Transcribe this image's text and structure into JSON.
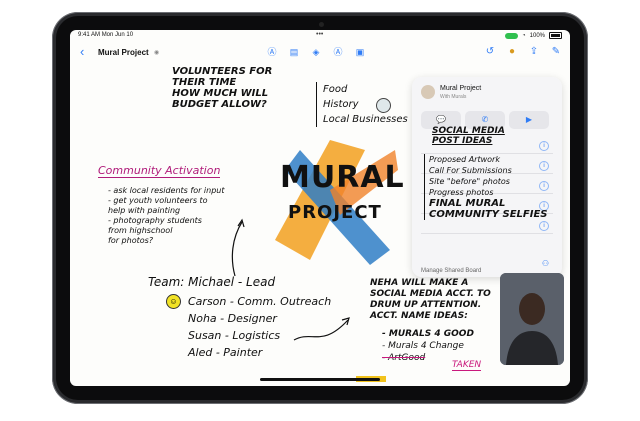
{
  "status_bar": {
    "time": "9:41 AM",
    "date": "Mon Jun 10",
    "battery": "100%"
  },
  "toolbar": {
    "title": "Mural Project"
  },
  "board": {
    "volunteer_note": [
      "VOLUNTEERS FOR",
      "THEIR TIME",
      "HOW MUCH WILL",
      "BUDGET ALLOW?"
    ],
    "list_items": [
      "Food",
      "History",
      "Local Businesses"
    ],
    "community_heading": "Community Activation",
    "community_items": [
      "- ask local residents for input",
      "- get youth volunteers to",
      "  help with painting",
      "- photography students",
      "  from highschool",
      "  for photos?"
    ],
    "logo_line1": "MURAL",
    "logo_line2": "PROJECT",
    "team_heading": "Team: Michael - Lead",
    "team_items": [
      "Carson - Comm. Outreach",
      "Noha - Designer",
      "Susan - Logistics",
      "Aled - Painter"
    ],
    "neha_note": [
      "NEHA WILL MAKE A",
      "SOCIAL MEDIA ACCT. TO",
      "DRUM UP ATTENTION.",
      "ACCT. NAME IDEAS:"
    ],
    "name_ideas": [
      "- MURALS 4 GOOD",
      "- Murals 4 Change",
      "- ArtGood"
    ],
    "taken_label": "TAKEN",
    "social_heading": [
      "SOCIAL MEDIA",
      "POST IDEAS"
    ],
    "social_items": [
      "Proposed Artwork",
      "Call For Submissions",
      "Site \"before\" photos",
      "Progress photos",
      "FINAL MURAL",
      "COMMUNITY SELFIES"
    ]
  },
  "popover": {
    "title": "Mural Project",
    "subtitle": "With Murals",
    "manage_label": "Manage Shared Board"
  }
}
